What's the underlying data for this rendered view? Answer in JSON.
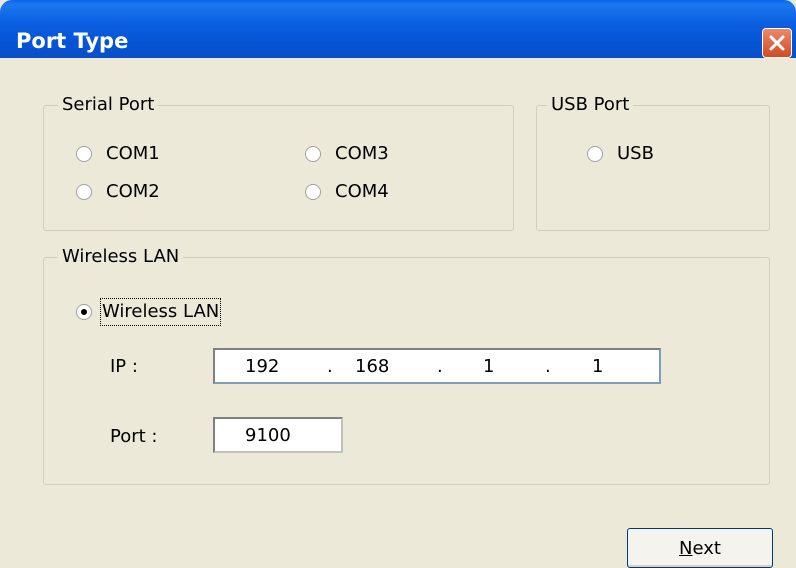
{
  "window": {
    "title": "Port Type",
    "close_icon": "close-icon"
  },
  "serial_port": {
    "label": "Serial Port",
    "options": [
      "COM1",
      "COM3",
      "COM2",
      "COM4"
    ]
  },
  "usb_port": {
    "label": "USB Port",
    "option": "USB"
  },
  "wireless": {
    "group_label": "Wireless LAN",
    "option": "Wireless LAN",
    "selected": true,
    "ip_label": "IP :",
    "ip_octets": [
      "192",
      "168",
      "1",
      "1"
    ],
    "ip_separator": ".",
    "port_label": "Port :",
    "port_value": "9100"
  },
  "buttons": {
    "next_mnemonic": "N",
    "next_rest": "ext"
  },
  "colors": {
    "titlebar": "#0554d5",
    "close_button": "#d24a22",
    "background": "#ece9d8"
  }
}
